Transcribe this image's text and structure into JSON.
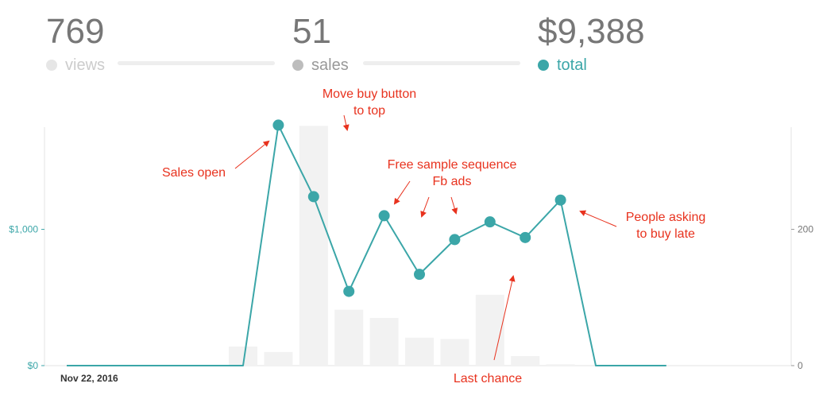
{
  "stats": {
    "views": {
      "value": "769",
      "label": "views",
      "color": "#e6e6e6",
      "text_color": "#cccccc"
    },
    "sales": {
      "value": "51",
      "label": "sales",
      "color": "#bdbdbd",
      "text_color": "#999999"
    },
    "total": {
      "value": "$9,388",
      "label": "total",
      "color": "#3ba6a8",
      "text_color": "#3ba6a8"
    }
  },
  "colors": {
    "line": "#3ba6a8",
    "bar": "#f2f2f2",
    "axis": "#e3e3e3",
    "annotation": "#e8321e"
  },
  "chart_data": {
    "type": "line",
    "x_start_label": "Nov 22, 2016",
    "left_axis": {
      "ylim": [
        0,
        1750
      ],
      "ticks": [
        {
          "value": 0,
          "label": "$0"
        },
        {
          "value": 1000,
          "label": "$1,000"
        }
      ]
    },
    "right_axis": {
      "ylim": [
        0,
        350
      ],
      "ticks": [
        {
          "value": 0,
          "label": "0"
        },
        {
          "value": 200,
          "label": "200"
        }
      ]
    },
    "series": [
      {
        "axis": "left",
        "render": "line",
        "values": [
          0,
          0,
          0,
          0,
          0,
          0,
          1765,
          1240,
          545,
          1100,
          670,
          925,
          1055,
          940,
          1215,
          0,
          0,
          0
        ]
      },
      {
        "axis": "right",
        "render": "bar",
        "values": [
          0,
          0,
          0,
          0,
          0,
          28,
          20,
          352,
          82,
          70,
          41,
          39,
          104,
          14,
          2,
          0,
          0,
          0
        ]
      }
    ],
    "markers_from_index": 6,
    "markers_to_index": 14,
    "annotations": [
      {
        "lines": [
          "Move buy button",
          "to top"
        ]
      },
      {
        "lines": [
          "Sales open"
        ]
      },
      {
        "lines": [
          "Free sample sequence",
          "Fb ads"
        ]
      },
      {
        "lines": [
          "People asking",
          "to buy late"
        ]
      },
      {
        "lines": [
          "Last chance"
        ]
      }
    ]
  }
}
